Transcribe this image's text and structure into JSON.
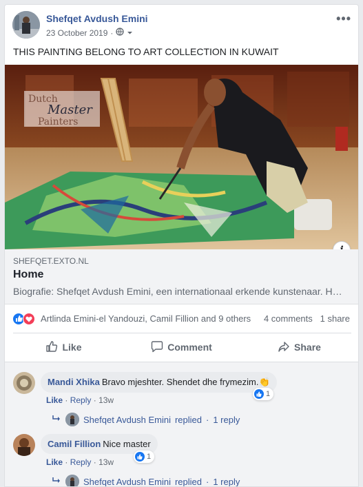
{
  "post": {
    "author": "Shefqet Avdush Emini",
    "date": "23 October 2019",
    "date_separator": "·",
    "text": "THIS PAINTING BELONG TO ART COLLECTION IN KUWAIT",
    "more_label": "•••"
  },
  "photo": {
    "watermark_line1": "Dutch",
    "watermark_line2": "Master",
    "watermark_line3": "Painters"
  },
  "link_preview": {
    "domain": "SHEFQET.EXTO.NL",
    "title": "Home",
    "description": "Biografie: Shefqet Avdush Emini, een internationaal erkende kunstenaar. Hij…",
    "info_label": "i"
  },
  "reactions": {
    "names": "Artlinda Emini-el Yandouzi, Camil Fillion and 9 others",
    "comments_count": "4 comments",
    "shares_count": "1 share"
  },
  "actions": {
    "like": "Like",
    "comment": "Comment",
    "share": "Share"
  },
  "comments": [
    {
      "author": "Mandi Xhika",
      "text": "Bravo mjeshter. Shendet dhe frymezim.",
      "emoji": "👏",
      "like_label": "Like",
      "reply_label": "Reply",
      "separator": "·",
      "time": "13w",
      "like_count": "1",
      "reply_author": "Shefqet Avdush Emini",
      "reply_verb": "replied",
      "reply_count": "1 reply"
    },
    {
      "author": "Camil Fillion",
      "text": "Nice master",
      "like_label": "Like",
      "reply_label": "Reply",
      "separator": "·",
      "time": "13w",
      "like_count": "1",
      "reply_author": "Shefqet Avdush Emini",
      "reply_verb": "replied",
      "reply_count": "1 reply"
    }
  ],
  "colors": {
    "link_blue": "#385898",
    "like_blue": "#1877f2",
    "love_red": "#f33e58",
    "page_bg": "#e9ebee"
  },
  "icons": {
    "privacy": "globe-icon",
    "like": "thumbs-up-icon",
    "comment": "speech-bubble-icon",
    "share": "share-arrow-icon",
    "reply": "reply-arrow-icon"
  }
}
